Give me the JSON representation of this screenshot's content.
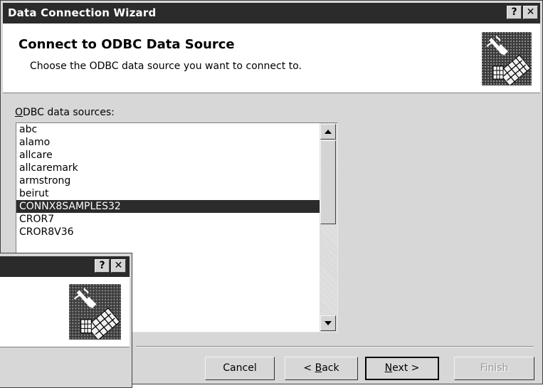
{
  "window": {
    "title": "Data Connection Wizard",
    "help_glyph": "?",
    "close_glyph": "✕"
  },
  "header": {
    "title": "Connect to ODBC Data Source",
    "subtitle": "Choose the ODBC data source you want to connect to.",
    "icon": "plug-database-icon"
  },
  "list": {
    "label": "ODBC data sources:",
    "label_mnemonic": "O",
    "label_rest": "DBC data sources:",
    "items": [
      "abc",
      "alamo",
      "allcare",
      "allcaremark",
      "armstrong",
      "beirut",
      "CONNX8SAMPLES32",
      "CROR7",
      "CROR8V36"
    ],
    "selected_index": 6
  },
  "buttons": {
    "cancel": "Cancel",
    "back": "< Back",
    "back_prefix": "< ",
    "back_mnemonic": "B",
    "back_rest": "ack",
    "next": "Next >",
    "next_mnemonic": "N",
    "next_rest": "ext >",
    "finish": "Finish"
  },
  "background_dialog": {
    "help_glyph": "?",
    "close_glyph": "✕",
    "icon": "plug-database-icon"
  },
  "colors": {
    "titlebar": "#2b2b2b",
    "dialog_bg": "#d7d7d7",
    "selection": "#2b2b2b"
  }
}
